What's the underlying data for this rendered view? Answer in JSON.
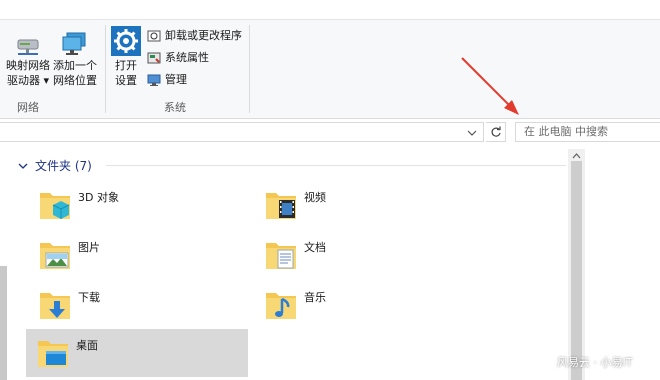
{
  "ribbon": {
    "group_network": {
      "label": "网络",
      "map_drive_line1": "映射网络",
      "map_drive_line2": "驱动器 ▾",
      "add_location_line1": "添加一个",
      "add_location_line2": "网络位置"
    },
    "group_system": {
      "label": "系统",
      "open_settings_line1": "打开",
      "open_settings_line2": "设置",
      "uninstall": "卸载或更改程序",
      "properties": "系统属性",
      "manage": "管理"
    }
  },
  "address_bar": {
    "refresh_icon": "refresh-icon",
    "search_placeholder": "在 此电脑 中搜索"
  },
  "section": {
    "title": "文件夹 (7)"
  },
  "folders": [
    {
      "label": "3D 对象",
      "icon": "folder-3d-objects-icon"
    },
    {
      "label": "视频",
      "icon": "folder-videos-icon"
    },
    {
      "label": "图片",
      "icon": "folder-pictures-icon"
    },
    {
      "label": "文档",
      "icon": "folder-documents-icon"
    },
    {
      "label": "下载",
      "icon": "folder-downloads-icon"
    },
    {
      "label": "音乐",
      "icon": "folder-music-icon"
    },
    {
      "label": "桌面",
      "icon": "folder-desktop-icon",
      "selected": true
    }
  ],
  "watermark": "风易云 · 小易IT",
  "colors": {
    "ribbon_bg": "#f7f8fa",
    "section_title": "#1e3287",
    "selection": "#d9d9d9",
    "folder_yellow": "#f4c752",
    "annotation_arrow": "#e23b2e"
  }
}
